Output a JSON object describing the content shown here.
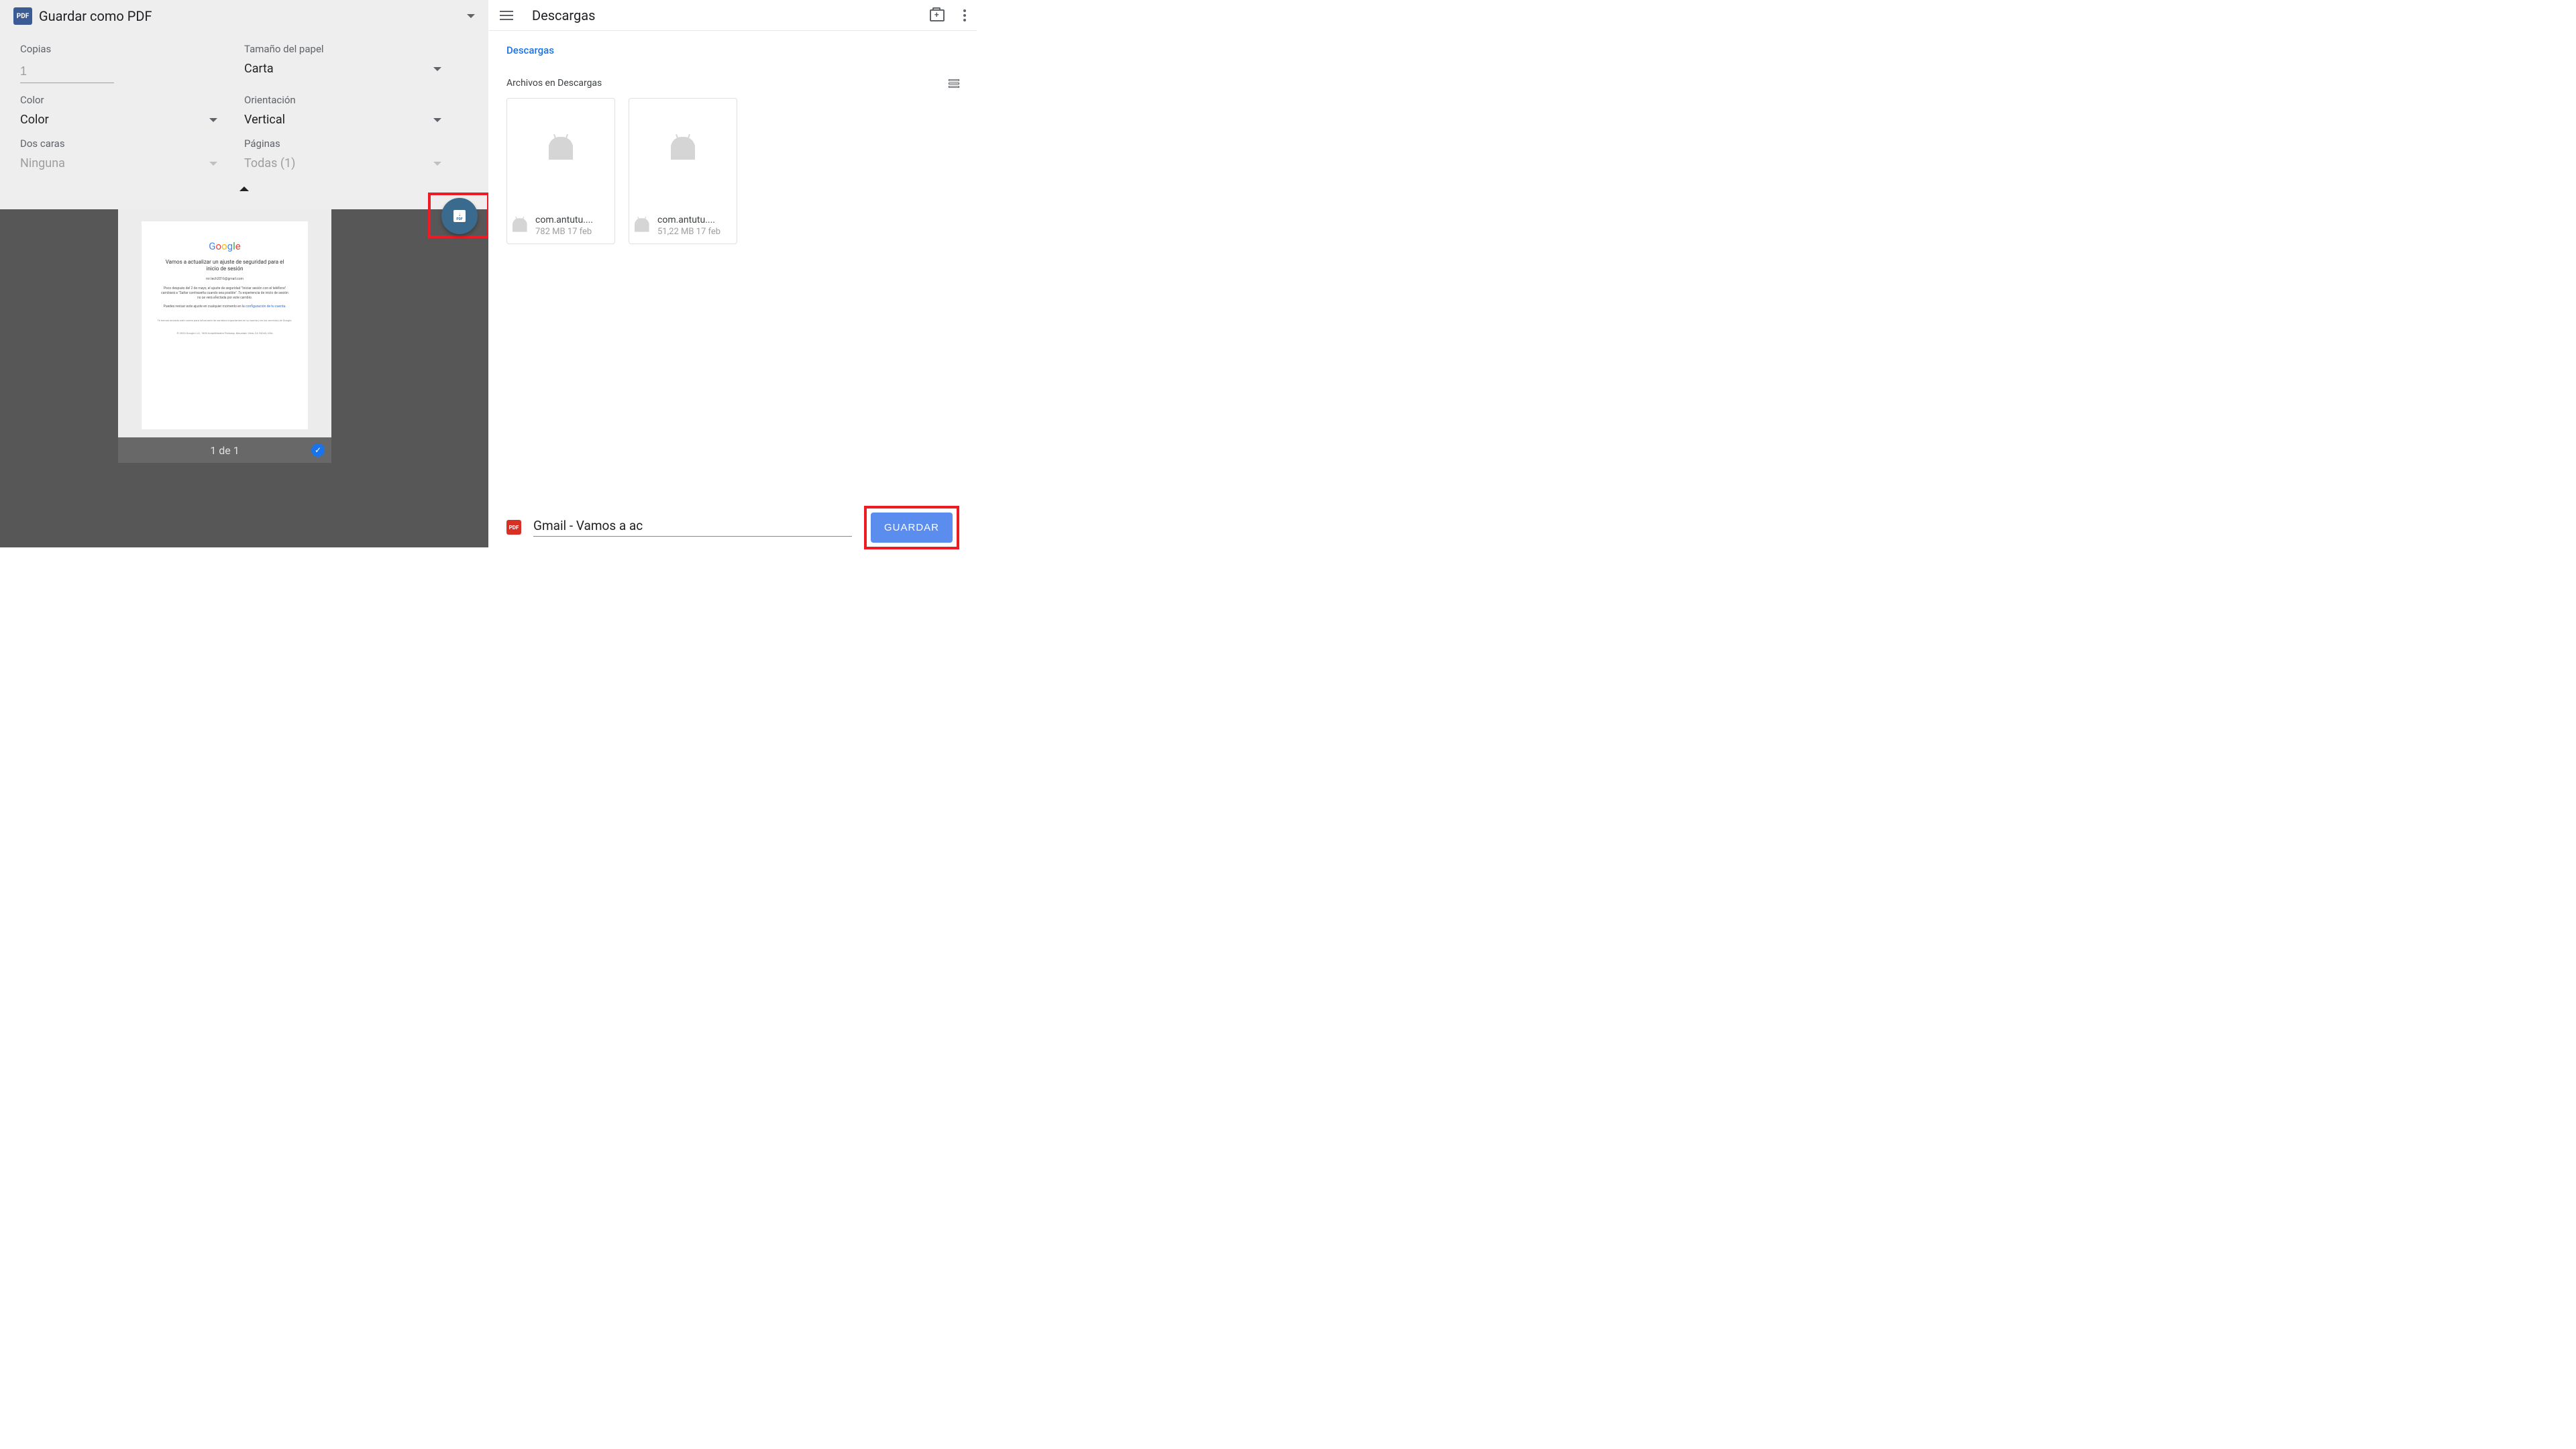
{
  "left": {
    "title": "Guardar como PDF",
    "options": {
      "copies_label": "Copias",
      "copies_value": "1",
      "paper_label": "Tamaño del papel",
      "paper_value": "Carta",
      "color_label": "Color",
      "color_value": "Color",
      "orient_label": "Orientación",
      "orient_value": "Vertical",
      "duplex_label": "Dos caras",
      "duplex_value": "Ninguna",
      "pages_label": "Páginas",
      "pages_value": "Todas (1)"
    },
    "preview": {
      "heading": "Vamos a actualizar un ajuste de seguridad para el inicio de sesión",
      "email": "mr.tech2016@gmail.com",
      "body1": "Poco después del 2 de mayo, el ajuste de seguridad \"Iniciar sesión con el teléfono\" cambiará a \"Saltar contraseña cuando sea posible\". Tu experiencia de inicio de sesión no se verá afectada por este cambio.",
      "body2_pre": "Puedes revisar este ajuste en cualquier momento en la ",
      "body2_link": "configuración de tu cuenta",
      "footer1": "Te hemos enviado este correo para informarte de cambios importantes en tu cuenta y en los servicios de Google.",
      "footer2": "© 2023 Google LLC, 1600 Amphitheatre Parkway, Mountain View, CA 94043, USA",
      "page_counter": "1 de 1"
    },
    "fab_label": "PDF"
  },
  "right": {
    "title": "Descargas",
    "breadcrumb": "Descargas",
    "section": "Archivos en Descargas",
    "files": [
      {
        "name": "com.antutu....",
        "sub": "782 MB 17 feb"
      },
      {
        "name": "com.antutu....",
        "sub": "51,22 MB 17 feb"
      }
    ],
    "save": {
      "badge": "PDF",
      "filename": "Gmail - Vamos a ac",
      "button": "GUARDAR"
    }
  }
}
